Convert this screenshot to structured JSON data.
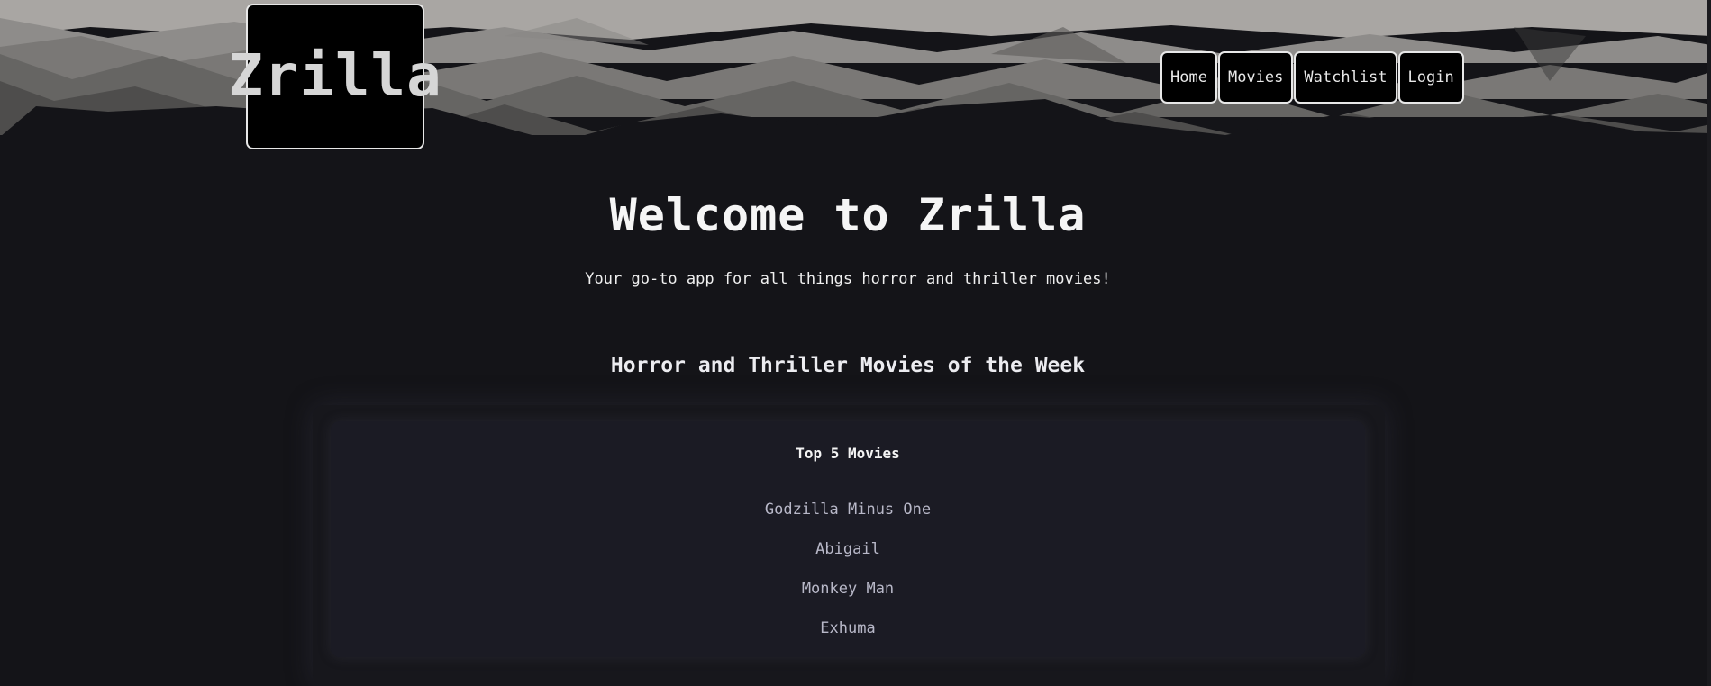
{
  "header": {
    "logo_text": "Zrilla",
    "nav": [
      {
        "label": "Home"
      },
      {
        "label": "Movies"
      },
      {
        "label": "Watchlist"
      },
      {
        "label": "Login"
      }
    ]
  },
  "hero": {
    "title": "Welcome to Zrilla",
    "subtitle": "Your go-to app for all things horror and thriller movies!"
  },
  "section": {
    "title": "Horror and Thriller Movies of the Week"
  },
  "top_movies": {
    "title": "Top 5 Movies",
    "items": [
      "Godzilla Minus One",
      "Abigail",
      "Monkey Man",
      "Exhuma"
    ]
  },
  "colors": {
    "background": "#141418",
    "panel": "#1b1b24",
    "button_bg": "#000000",
    "button_border": "#e8e8e8",
    "list_text": "#b8b8c8"
  }
}
